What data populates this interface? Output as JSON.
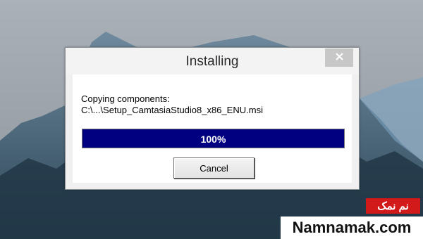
{
  "dialog": {
    "title": "Installing",
    "status_line": "Copying components:",
    "file_path": "C:\\...\\Setup_CamtasiaStudio8_x86_ENU.msi",
    "progress_percent": 100,
    "progress_label": "100%",
    "cancel_label": "Cancel"
  },
  "watermark": {
    "brand_fa": "نم نمک",
    "site": "Namnamak.com"
  },
  "colors": {
    "progress_fill": "#000080",
    "watermark_red": "#d21a1a"
  },
  "icons": {
    "close": "close-icon"
  }
}
